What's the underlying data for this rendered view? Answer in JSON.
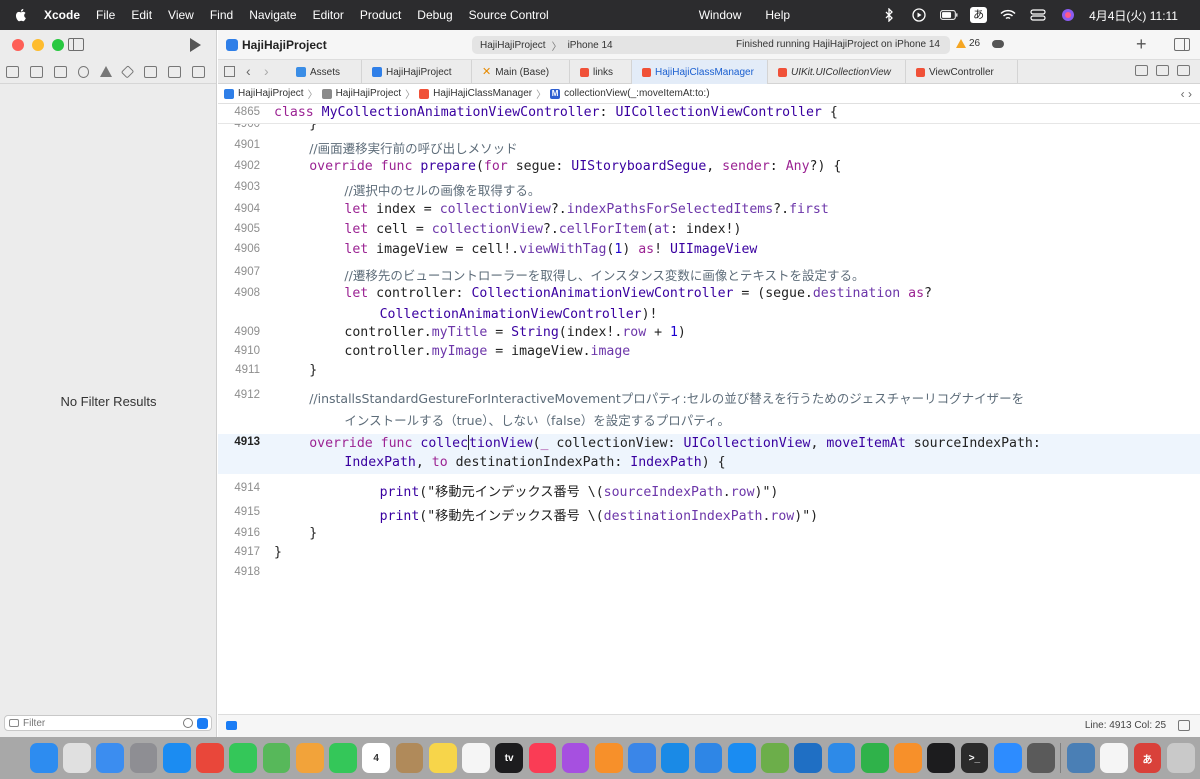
{
  "menubar": {
    "app_name": "Xcode",
    "items": [
      "File",
      "Edit",
      "View",
      "Find",
      "Navigate",
      "Editor",
      "Product",
      "Debug",
      "Source Control"
    ],
    "right_items": [
      "Window",
      "Help"
    ],
    "input_method": "あ",
    "clock": "4月4日(火)  11:11"
  },
  "sidebar": {
    "empty_message": "No Filter Results",
    "filter_placeholder": "Filter"
  },
  "toolbar": {
    "project_title": "HajiHajiProject",
    "scheme_app": "HajiHajiProject",
    "scheme_device": "iPhone 14",
    "status": "Finished running HajiHajiProject on iPhone 14",
    "warning_count": "26"
  },
  "tabs": [
    {
      "label": "Assets",
      "icon": "assets-icon"
    },
    {
      "label": "HajiHajiProject",
      "icon": "project-icon"
    },
    {
      "label": "Main (Base)",
      "icon": "storyboard-icon"
    },
    {
      "label": "links",
      "icon": "swift-icon"
    },
    {
      "label": "HajiHajiClassManager",
      "icon": "swift-icon",
      "active": true
    },
    {
      "label": "UIKit.UICollectionView",
      "icon": "swift-icon"
    },
    {
      "label": "ViewController",
      "icon": "swift-icon"
    }
  ],
  "jumpbar": {
    "crumbs": [
      "HajiHajiProject",
      "HajiHajiProject",
      "HajiHajiClassManager",
      "collectionView(_:moveItemAt:to:)"
    ]
  },
  "editor": {
    "sticky_line": "4865",
    "sticky_tokens": [
      [
        "kw",
        "class"
      ],
      [
        "p",
        " "
      ],
      [
        "ty",
        "MyCollectionAnimationViewController"
      ],
      [
        "p",
        ": "
      ],
      [
        "ty",
        "UICollectionViewController"
      ],
      [
        "p",
        " {"
      ]
    ],
    "lines": [
      {
        "n": "4900",
        "indent": 2,
        "tokens": [
          [
            "p",
            "}"
          ]
        ]
      },
      {
        "n": "4901",
        "indent": 2,
        "tokens": [
          [
            "cmt",
            "//画面遷移実行前の呼び出しメソッド"
          ]
        ]
      },
      {
        "n": "4902",
        "indent": 2,
        "tokens": [
          [
            "kw",
            "override"
          ],
          [
            "p",
            " "
          ],
          [
            "kw",
            "func"
          ],
          [
            "p",
            " "
          ],
          [
            "fn",
            "prepare"
          ],
          [
            "p",
            "("
          ],
          [
            "kw",
            "for"
          ],
          [
            "p",
            " segue: "
          ],
          [
            "ty",
            "UIStoryboardSegue"
          ],
          [
            "p",
            ", "
          ],
          [
            "kw",
            "sender"
          ],
          [
            "p",
            ": "
          ],
          [
            "kw",
            "Any"
          ],
          [
            "p",
            "?) {"
          ]
        ]
      },
      {
        "n": "4903",
        "indent": 4,
        "tokens": [
          [
            "cmt",
            "//選択中のセルの画像を取得する。"
          ]
        ]
      },
      {
        "n": "4904",
        "indent": 4,
        "tokens": [
          [
            "kw",
            "let"
          ],
          [
            "p",
            " index = "
          ],
          [
            "mem",
            "collectionView"
          ],
          [
            "p",
            "?."
          ],
          [
            "mem",
            "indexPathsForSelectedItems"
          ],
          [
            "p",
            "?."
          ],
          [
            "mem",
            "first"
          ]
        ]
      },
      {
        "n": "4905",
        "indent": 4,
        "tokens": [
          [
            "kw",
            "let"
          ],
          [
            "p",
            " cell = "
          ],
          [
            "mem",
            "collectionView"
          ],
          [
            "p",
            "?."
          ],
          [
            "mem",
            "cellForItem"
          ],
          [
            "p",
            "("
          ],
          [
            "mem",
            "at"
          ],
          [
            "p",
            ": index!)"
          ]
        ]
      },
      {
        "n": "4906",
        "indent": 4,
        "tokens": [
          [
            "kw",
            "let"
          ],
          [
            "p",
            " imageView = cell!."
          ],
          [
            "mem",
            "viewWithTag"
          ],
          [
            "p",
            "("
          ],
          [
            "num",
            "1"
          ],
          [
            "p",
            ") "
          ],
          [
            "kw",
            "as"
          ],
          [
            "p",
            "! "
          ],
          [
            "ty",
            "UIImageView"
          ]
        ]
      },
      {
        "n": "4907",
        "indent": 4,
        "tokens": [
          [
            "cmt",
            "//遷移先のビューコントローラーを取得し、インスタンス変数に画像とテキストを設定する。"
          ]
        ]
      },
      {
        "n": "4908",
        "indent": 4,
        "tokens": [
          [
            "kw",
            "let"
          ],
          [
            "p",
            " controller: "
          ],
          [
            "ty",
            "CollectionAnimationViewController"
          ],
          [
            "p",
            " = (segue."
          ],
          [
            "mem",
            "destination"
          ],
          [
            "p",
            " "
          ],
          [
            "kw",
            "as"
          ],
          [
            "p",
            "?"
          ]
        ]
      },
      {
        "n": "",
        "indent": 6,
        "tokens": [
          [
            "ty",
            "CollectionAnimationViewController"
          ],
          [
            "p",
            ")!"
          ]
        ]
      },
      {
        "n": "4909",
        "indent": 4,
        "tokens": [
          [
            "p",
            "controller."
          ],
          [
            "mem",
            "myTitle"
          ],
          [
            "p",
            " = "
          ],
          [
            "ty",
            "String"
          ],
          [
            "p",
            "(index!."
          ],
          [
            "mem",
            "row"
          ],
          [
            "p",
            " + "
          ],
          [
            "num",
            "1"
          ],
          [
            "p",
            ")"
          ]
        ]
      },
      {
        "n": "4910",
        "indent": 4,
        "tokens": [
          [
            "p",
            "controller."
          ],
          [
            "mem",
            "myImage"
          ],
          [
            "p",
            " = imageView."
          ],
          [
            "mem",
            "image"
          ]
        ]
      },
      {
        "n": "4911",
        "indent": 2,
        "tokens": [
          [
            "p",
            "}"
          ]
        ]
      },
      {
        "n": "4912",
        "indent": 2,
        "tokens": [
          [
            "cmt",
            "//installsStandardGestureForInteractiveMovementプロパティ:セルの並び替えを行うためのジェスチャーリコグナイザーを"
          ]
        ]
      },
      {
        "n": "",
        "indent": 4,
        "tokens": [
          [
            "cmt",
            "インストールする（true）、しない（false）を設定するプロパティ。"
          ]
        ]
      },
      {
        "n": "4913",
        "indent": 2,
        "current": true,
        "tokens": [
          [
            "kw",
            "override"
          ],
          [
            "p",
            " "
          ],
          [
            "kw",
            "func"
          ],
          [
            "p",
            " "
          ],
          [
            "fn",
            "collec"
          ],
          [
            "caret",
            ""
          ],
          [
            "fn",
            "tionView"
          ],
          [
            "p",
            "("
          ],
          [
            "kw",
            "_"
          ],
          [
            "p",
            " collectionView: "
          ],
          [
            "ty",
            "UICollectionView"
          ],
          [
            "p",
            ", "
          ],
          [
            "fn",
            "moveItemAt"
          ],
          [
            "p",
            " sourceIndexPath:"
          ]
        ]
      },
      {
        "n": "",
        "indent": 4,
        "current": true,
        "tokens": [
          [
            "ty",
            "IndexPath"
          ],
          [
            "p",
            ", "
          ],
          [
            "kw",
            "to"
          ],
          [
            "p",
            " destinationIndexPath: "
          ],
          [
            "ty",
            "IndexPath"
          ],
          [
            "p",
            ") {"
          ]
        ]
      },
      {
        "n": "4914",
        "indent": 6,
        "tokens": [
          [
            "fn",
            "print"
          ],
          [
            "p",
            "(\"移動元インデックス番号 \\("
          ],
          [
            "mem",
            "sourceIndexPath"
          ],
          [
            "p",
            "."
          ],
          [
            "mem",
            "row"
          ],
          [
            "p",
            ")\")"
          ]
        ]
      },
      {
        "n": "4915",
        "indent": 6,
        "tokens": [
          [
            "fn",
            "print"
          ],
          [
            "p",
            "(\"移動先インデックス番号 \\("
          ],
          [
            "mem",
            "destinationIndexPath"
          ],
          [
            "p",
            "."
          ],
          [
            "mem",
            "row"
          ],
          [
            "p",
            ")\")"
          ]
        ]
      },
      {
        "n": "4916",
        "indent": 2,
        "tokens": [
          [
            "p",
            "}"
          ]
        ]
      },
      {
        "n": "4917",
        "indent": 0,
        "tokens": [
          [
            "p",
            "}"
          ]
        ]
      },
      {
        "n": "4918",
        "indent": 0,
        "tokens": []
      }
    ]
  },
  "statusbar": {
    "line_col": "Line: 4913  Col: 25"
  },
  "dock": {
    "apps": [
      {
        "name": "finder",
        "color": "#2d8cf0",
        "label": ""
      },
      {
        "name": "launchpad",
        "color": "#e0e0e0",
        "label": ""
      },
      {
        "name": "mail",
        "color": "#3b8df0",
        "label": ""
      },
      {
        "name": "system-settings",
        "color": "#8e8e93",
        "label": ""
      },
      {
        "name": "safari",
        "color": "#1b8cf2",
        "label": ""
      },
      {
        "name": "chrome",
        "color": "#e9473a",
        "label": ""
      },
      {
        "name": "messages",
        "color": "#34c759",
        "label": ""
      },
      {
        "name": "maps",
        "color": "#57b85a",
        "label": ""
      },
      {
        "name": "photos",
        "color": "#f2a33a",
        "label": ""
      },
      {
        "name": "facetime",
        "color": "#34c759",
        "label": ""
      },
      {
        "name": "calendar",
        "color": "#ffffff",
        "label": "4"
      },
      {
        "name": "contacts",
        "color": "#b08a5a",
        "label": ""
      },
      {
        "name": "notes",
        "color": "#f7d54a",
        "label": ""
      },
      {
        "name": "reminders",
        "color": "#f5f5f5",
        "label": ""
      },
      {
        "name": "tv",
        "color": "#1c1c1e",
        "label": "tv"
      },
      {
        "name": "music",
        "color": "#fa3c55",
        "label": ""
      },
      {
        "name": "podcasts",
        "color": "#a650e0",
        "label": ""
      },
      {
        "name": "books",
        "color": "#f7902a",
        "label": ""
      },
      {
        "name": "freeform",
        "color": "#3a86e8",
        "label": ""
      },
      {
        "name": "instruments",
        "color": "#1a8ae6",
        "label": ""
      },
      {
        "name": "simulator",
        "color": "#2e86e6",
        "label": ""
      },
      {
        "name": "app-store",
        "color": "#1a8cf2",
        "label": ""
      },
      {
        "name": "archive-utility",
        "color": "#6cae4a",
        "label": ""
      },
      {
        "name": "vscode",
        "color": "#1f6fc4",
        "label": ""
      },
      {
        "name": "keynote",
        "color": "#2d8ae8",
        "label": ""
      },
      {
        "name": "numbers",
        "color": "#2fb24a",
        "label": ""
      },
      {
        "name": "pages",
        "color": "#f7902a",
        "label": ""
      },
      {
        "name": "chatgpt",
        "color": "#1c1c1e",
        "label": ""
      },
      {
        "name": "terminal",
        "color": "#2b2b2b",
        "label": ">_"
      },
      {
        "name": "zoom",
        "color": "#2d8cff",
        "label": ""
      },
      {
        "name": "calculator",
        "color": "#5a5a5a",
        "label": ""
      }
    ],
    "apps_after_divider": [
      {
        "name": "preview",
        "color": "#4a7fb5",
        "label": ""
      },
      {
        "name": "textedit",
        "color": "#f5f5f5",
        "label": ""
      },
      {
        "name": "kotoeri",
        "color": "#d9413a",
        "label": "あ"
      },
      {
        "name": "trash",
        "color": "#c9c9c9",
        "label": ""
      }
    ]
  }
}
